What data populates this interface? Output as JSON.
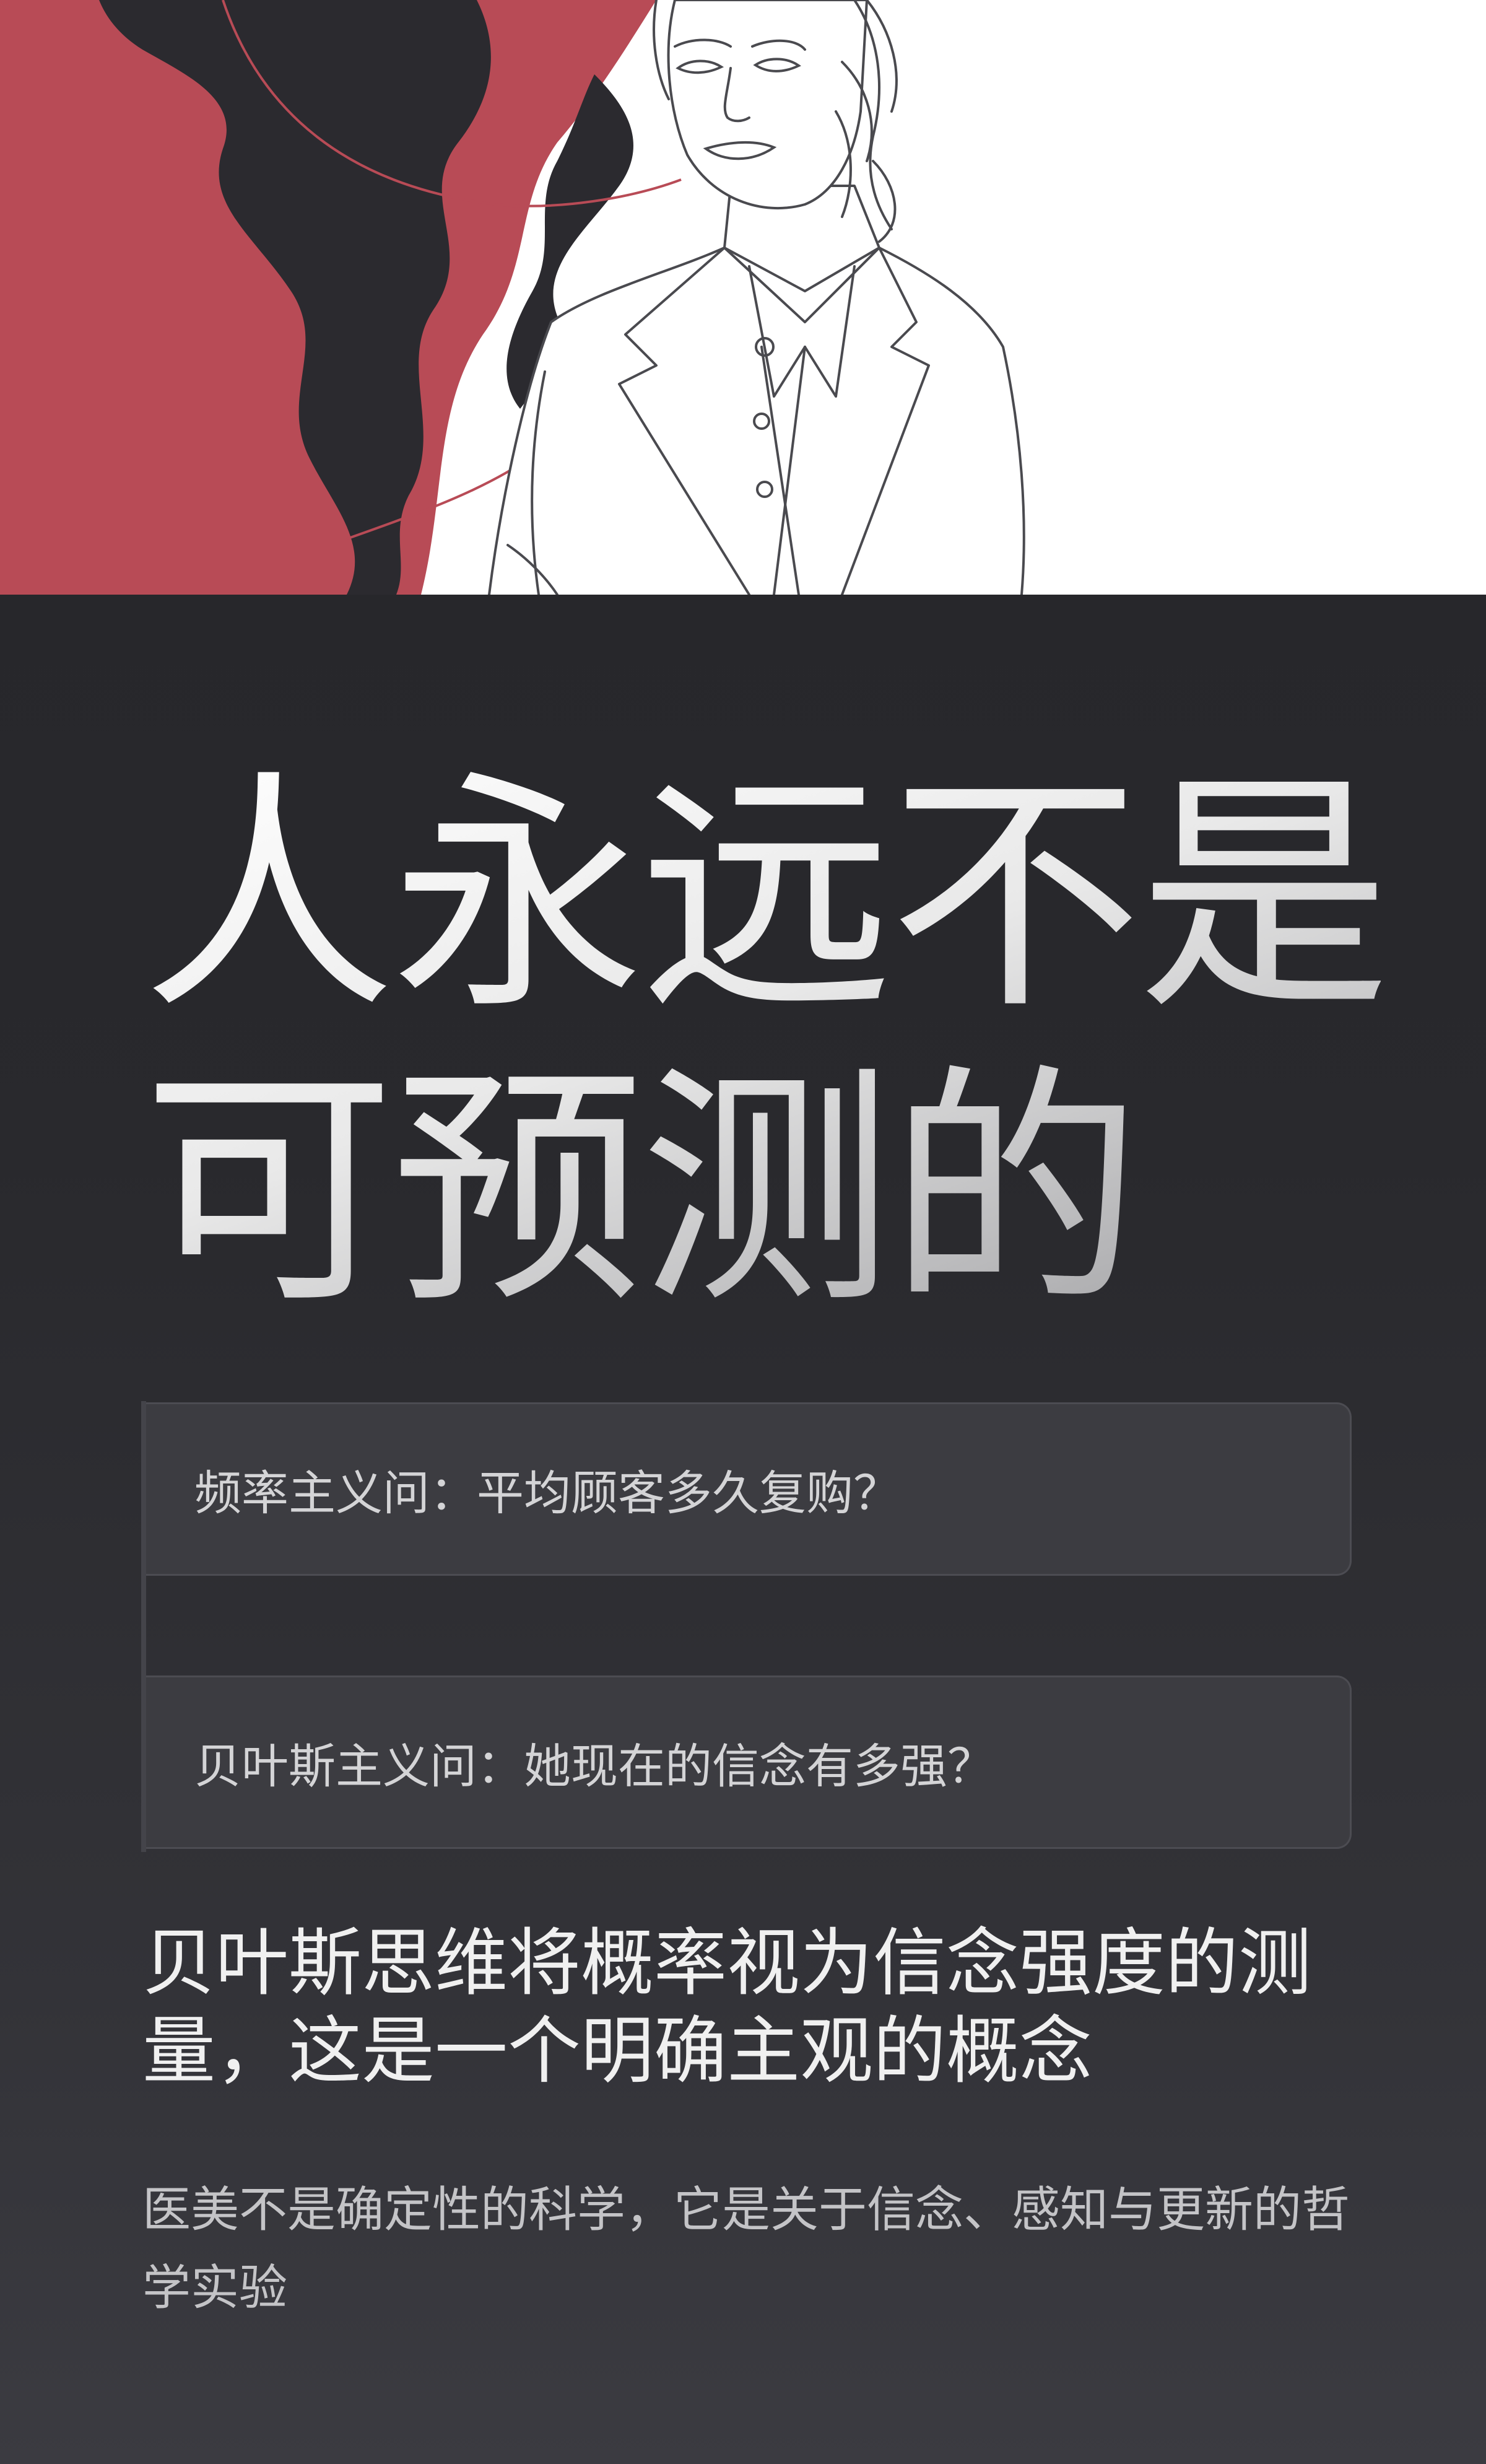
{
  "hero": {
    "illustration": "woman-in-blazer-line-art",
    "colors": {
      "accent_red": "#b84b56",
      "shape_dark": "#2b2a2f",
      "background": "#ffffff",
      "line": "#4a4a4f"
    }
  },
  "headline": {
    "line1": "人永远不是",
    "line2": "可预测的"
  },
  "questions": [
    {
      "text": "频率主义问：平均顾客多久复购？"
    },
    {
      "text": "贝叶斯主义问：她现在的信念有多强？"
    }
  ],
  "statement": {
    "line1": "贝叶斯思维将概率视为信念强度的测",
    "line2": "量，这是一个明确主观的概念"
  },
  "subtext": {
    "line1": "医美不是确定性的科学，它是关于信念、感知与更新的哲",
    "line2": "学实验"
  },
  "theme": {
    "background": "#27272b",
    "card_background": "#3c3c41",
    "card_border": "#4c4c52"
  }
}
